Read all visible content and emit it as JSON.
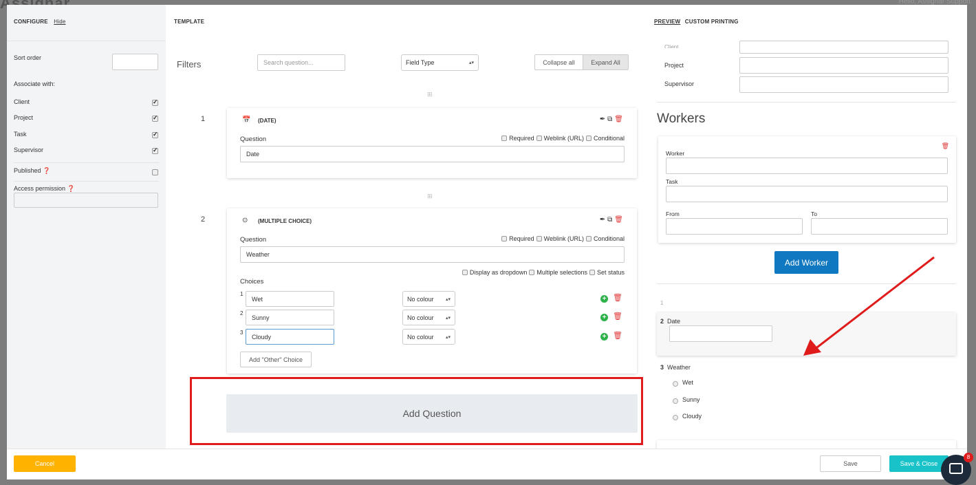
{
  "background": {
    "app_logo": "Assignar",
    "user_greeting": "Hello, Assignar Support"
  },
  "configure": {
    "header": "CONFIGURE",
    "hide_link": "Hide",
    "sort_order_label": "Sort order",
    "sort_order_value": "",
    "associate_label": "Associate with:",
    "associations": [
      {
        "label": "Client",
        "checked": true
      },
      {
        "label": "Project",
        "checked": true
      },
      {
        "label": "Task",
        "checked": true
      },
      {
        "label": "Supervisor",
        "checked": true
      }
    ],
    "published_label": "Published",
    "access_permission_label": "Access permission",
    "access_permission_value": ""
  },
  "template": {
    "header": "TEMPLATE",
    "filters_label": "Filters",
    "search_placeholder": "Search question...",
    "field_type_select": "Field Type",
    "collapse_all": "Collapse all",
    "expand_all": "Expand All",
    "add_sep_icon": "⊞",
    "questions": [
      {
        "number": "1",
        "type": "(DATE)",
        "question_label": "Question",
        "question_value": "Date",
        "options": [
          "Required",
          "Weblink (URL)",
          "Conditional"
        ]
      },
      {
        "number": "2",
        "type": "(MULTIPLE CHOICE)",
        "question_label": "Question",
        "question_value": "Weather",
        "options": [
          "Required",
          "Weblink (URL)",
          "Conditional"
        ],
        "choice_options": [
          "Display as dropdown",
          "Multiple selections",
          "Set status"
        ],
        "choices_label": "Choices",
        "choices": [
          {
            "num": "1",
            "value": "Wet",
            "colour": "No colour"
          },
          {
            "num": "2",
            "value": "Sunny",
            "colour": "No colour"
          },
          {
            "num": "3",
            "value": "Cloudy",
            "colour": "No colour"
          }
        ],
        "add_other_choice": "Add \"Other\" Choice"
      }
    ],
    "add_question": "Add Question"
  },
  "preview": {
    "tab_preview": "PREVIEW",
    "tab_custom_printing": "CUSTOM PRINTING",
    "fields": [
      "Client",
      "Project",
      "Supervisor"
    ],
    "workers_title": "Workers",
    "worker_label": "Worker",
    "task_label": "Task",
    "from_label": "From",
    "to_label": "To",
    "add_worker": "Add Worker",
    "items": [
      {
        "num": "1",
        "label": ""
      },
      {
        "num": "2",
        "label": "Date"
      },
      {
        "num": "3",
        "label": "Weather"
      }
    ],
    "weather_choices": [
      "Wet",
      "Sunny",
      "Cloudy"
    ]
  },
  "footer": {
    "cancel": "Cancel",
    "save": "Save",
    "save_close": "Save & Close"
  },
  "chat": {
    "badge": "8"
  },
  "colors": {
    "cancel": "#ffb300",
    "save_close": "#17c3c9",
    "add_worker": "#1078c0",
    "annotation_red": "#e01b1b"
  }
}
